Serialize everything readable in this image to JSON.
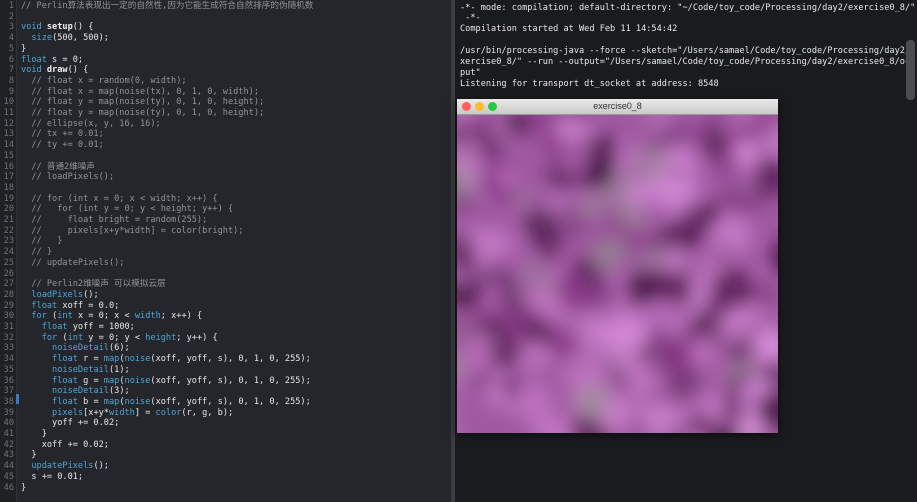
{
  "editor": {
    "lines": [
      {
        "n": "1",
        "segs": [
          [
            "comment",
            "// Perlin算法表现出一定的自然性,因为它能生成符合自然排序的伪随机数"
          ]
        ]
      },
      {
        "n": "2",
        "segs": []
      },
      {
        "n": "3",
        "segs": [
          [
            "kw",
            "void "
          ],
          [
            "fn",
            "setup"
          ],
          [
            "plain",
            "() {"
          ]
        ]
      },
      {
        "n": "4",
        "segs": [
          [
            "plain",
            "  "
          ],
          [
            "kw",
            "size"
          ],
          [
            "plain",
            "(500, 500);"
          ]
        ]
      },
      {
        "n": "5",
        "segs": [
          [
            "plain",
            "}"
          ]
        ]
      },
      {
        "n": "6",
        "segs": [
          [
            "kw",
            "float "
          ],
          [
            "plain",
            "s = 0;"
          ]
        ]
      },
      {
        "n": "7",
        "segs": [
          [
            "kw",
            "void "
          ],
          [
            "fn",
            "draw"
          ],
          [
            "plain",
            "() {"
          ]
        ]
      },
      {
        "n": "8",
        "segs": [
          [
            "comment",
            "  // float x = random(0, width);"
          ]
        ]
      },
      {
        "n": "9",
        "segs": [
          [
            "comment",
            "  // float x = map(noise(tx), 0, 1, 0, width);"
          ]
        ]
      },
      {
        "n": "10",
        "segs": [
          [
            "comment",
            "  // float y = map(noise(ty), 0, 1, 0, height);"
          ]
        ]
      },
      {
        "n": "11",
        "segs": [
          [
            "comment",
            "  // float y = map(noise(ty), 0, 1, 0, height);"
          ]
        ]
      },
      {
        "n": "12",
        "segs": [
          [
            "comment",
            "  // ellipse(x, y, 16, 16);"
          ]
        ]
      },
      {
        "n": "13",
        "segs": [
          [
            "comment",
            "  // tx += 0.01;"
          ]
        ]
      },
      {
        "n": "14",
        "segs": [
          [
            "comment",
            "  // ty += 0.01;"
          ]
        ]
      },
      {
        "n": "15",
        "segs": []
      },
      {
        "n": "16",
        "segs": [
          [
            "comment",
            "  // 普通2维噪声"
          ]
        ]
      },
      {
        "n": "17",
        "segs": [
          [
            "comment",
            "  // loadPixels();"
          ]
        ]
      },
      {
        "n": "18",
        "segs": []
      },
      {
        "n": "19",
        "segs": [
          [
            "comment",
            "  // for (int x = 0; x < width; x++) {"
          ]
        ]
      },
      {
        "n": "20",
        "segs": [
          [
            "comment",
            "  //   for (int y = 0; y < height; y++) {"
          ]
        ]
      },
      {
        "n": "21",
        "segs": [
          [
            "comment",
            "  //     float bright = random(255);"
          ]
        ]
      },
      {
        "n": "22",
        "segs": [
          [
            "comment",
            "  //     pixels[x+y*width] = color(bright);"
          ]
        ]
      },
      {
        "n": "23",
        "segs": [
          [
            "comment",
            "  //   }"
          ]
        ]
      },
      {
        "n": "24",
        "segs": [
          [
            "comment",
            "  // }"
          ]
        ]
      },
      {
        "n": "25",
        "segs": [
          [
            "comment",
            "  // updatePixels();"
          ]
        ]
      },
      {
        "n": "26",
        "segs": []
      },
      {
        "n": "27",
        "segs": [
          [
            "comment",
            "  // Perlin2维噪声 可以模拟云层"
          ]
        ]
      },
      {
        "n": "28",
        "segs": [
          [
            "plain",
            "  "
          ],
          [
            "kw",
            "loadPixels"
          ],
          [
            "plain",
            "();"
          ]
        ]
      },
      {
        "n": "29",
        "segs": [
          [
            "plain",
            "  "
          ],
          [
            "kw",
            "float "
          ],
          [
            "plain",
            "xoff = 0.0;"
          ]
        ]
      },
      {
        "n": "30",
        "segs": [
          [
            "plain",
            "  "
          ],
          [
            "kw",
            "for "
          ],
          [
            "plain",
            "("
          ],
          [
            "kw",
            "int "
          ],
          [
            "plain",
            "x = 0; x < "
          ],
          [
            "kw",
            "width"
          ],
          [
            "plain",
            "; x++) {"
          ]
        ]
      },
      {
        "n": "31",
        "segs": [
          [
            "plain",
            "    "
          ],
          [
            "kw",
            "float "
          ],
          [
            "plain",
            "yoff = 1000;"
          ]
        ]
      },
      {
        "n": "32",
        "segs": [
          [
            "plain",
            "    "
          ],
          [
            "kw",
            "for "
          ],
          [
            "plain",
            "("
          ],
          [
            "kw",
            "int "
          ],
          [
            "plain",
            "y = 0; y < "
          ],
          [
            "kw",
            "height"
          ],
          [
            "plain",
            "; y++) {"
          ]
        ]
      },
      {
        "n": "33",
        "segs": [
          [
            "plain",
            "      "
          ],
          [
            "kw",
            "noiseDetail"
          ],
          [
            "plain",
            "(6);"
          ]
        ]
      },
      {
        "n": "34",
        "segs": [
          [
            "plain",
            "      "
          ],
          [
            "kw",
            "float "
          ],
          [
            "plain",
            "r = "
          ],
          [
            "kw",
            "map"
          ],
          [
            "plain",
            "("
          ],
          [
            "kw",
            "noise"
          ],
          [
            "plain",
            "(xoff, yoff, s), 0, 1, 0, 255);"
          ]
        ]
      },
      {
        "n": "35",
        "segs": [
          [
            "plain",
            "      "
          ],
          [
            "kw",
            "noiseDetail"
          ],
          [
            "plain",
            "(1);"
          ]
        ]
      },
      {
        "n": "36",
        "segs": [
          [
            "plain",
            "      "
          ],
          [
            "kw",
            "float "
          ],
          [
            "plain",
            "g = "
          ],
          [
            "kw",
            "map"
          ],
          [
            "plain",
            "("
          ],
          [
            "kw",
            "noise"
          ],
          [
            "plain",
            "(xoff, yoff, s), 0, 1, 0, 255);"
          ]
        ]
      },
      {
        "n": "37",
        "segs": [
          [
            "plain",
            "      "
          ],
          [
            "kw",
            "noiseDetail"
          ],
          [
            "plain",
            "(3);"
          ]
        ]
      },
      {
        "n": "38",
        "segs": [
          [
            "plain",
            "      "
          ],
          [
            "kw",
            "float "
          ],
          [
            "plain",
            "b = "
          ],
          [
            "kw",
            "map"
          ],
          [
            "plain",
            "("
          ],
          [
            "kw",
            "noise"
          ],
          [
            "plain",
            "(xoff, yoff, s), 0, 1, 0, 255);"
          ]
        ]
      },
      {
        "n": "39",
        "segs": [
          [
            "plain",
            "      "
          ],
          [
            "kw",
            "pixels"
          ],
          [
            "plain",
            "[x+y*"
          ],
          [
            "kw",
            "width"
          ],
          [
            "plain",
            "] = "
          ],
          [
            "kw",
            "color"
          ],
          [
            "plain",
            "(r, g, b);"
          ]
        ]
      },
      {
        "n": "40",
        "segs": [
          [
            "plain",
            "      yoff += 0.02;"
          ]
        ]
      },
      {
        "n": "41",
        "segs": [
          [
            "plain",
            "    }"
          ]
        ]
      },
      {
        "n": "42",
        "segs": [
          [
            "plain",
            "    xoff += 0.02;"
          ]
        ]
      },
      {
        "n": "43",
        "segs": [
          [
            "plain",
            "  }"
          ]
        ]
      },
      {
        "n": "44",
        "segs": [
          [
            "plain",
            "  "
          ],
          [
            "kw",
            "updatePixels"
          ],
          [
            "plain",
            "();"
          ]
        ]
      },
      {
        "n": "45",
        "segs": [
          [
            "plain",
            "  s += 0.01;"
          ]
        ]
      },
      {
        "n": "46",
        "segs": [
          [
            "plain",
            "}"
          ]
        ]
      }
    ]
  },
  "terminal": {
    "lines": [
      "-*- mode: compilation; default-directory: \"~/Code/toy_code/Processing/day2/exercise0_8/\"",
      " -*-",
      "Compilation started at Wed Feb 11 14:54:42",
      "",
      "/usr/bin/processing-java --force --sketch=\"/Users/samael/Code/toy_code/Processing/day2/e",
      "xercise0_8/\" --run --output=\"/Users/samael/Code/toy_code/Processing/day2/exercise0_8/out",
      "put\"",
      "Listening for transport dt_socket at address: 8548"
    ]
  },
  "sketch_window": {
    "title": "exercise0_8"
  },
  "colors": {
    "editor_bg": "#24262b",
    "terminal_bg": "#1a1b1e",
    "keyword": "#4ca6d8",
    "comment": "#8e959c",
    "close": "#ff5f57",
    "minimize": "#febc2e",
    "zoom": "#28c840",
    "noise_base": "#a057a0"
  }
}
